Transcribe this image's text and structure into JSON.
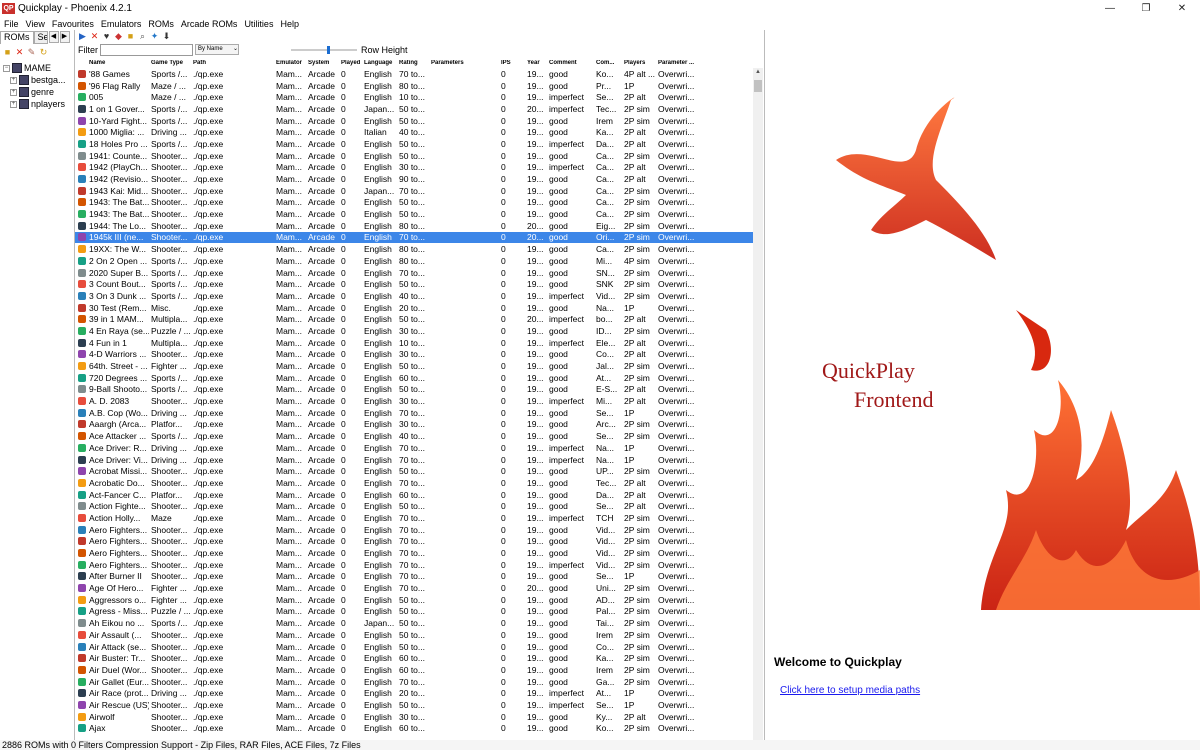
{
  "window": {
    "title": "Quickplay - Phoenix 4.2.1",
    "app_icon": "QP"
  },
  "menu": [
    "File",
    "View",
    "Favourites",
    "Emulators",
    "ROMs",
    "Arcade ROMs",
    "Utilities",
    "Help"
  ],
  "left": {
    "tabs": [
      "ROMs",
      "Se"
    ],
    "tree": [
      {
        "label": "MAME",
        "expander": "−"
      },
      {
        "label": "bestga...",
        "expander": "+"
      },
      {
        "label": "genre",
        "expander": "+"
      },
      {
        "label": "nplayers",
        "expander": "+"
      }
    ]
  },
  "filter": {
    "label": "Filter",
    "value": "",
    "sort": "By Name",
    "row_height_label": "Row Height"
  },
  "columns": [
    "Name",
    "Game Type",
    "Path",
    "Emulator",
    "System",
    "Played",
    "Language",
    "Rating",
    "Parameters",
    "IPS",
    "Year",
    "Comment",
    "Com...",
    "Players",
    "Parameter ..."
  ],
  "icon_colors": [
    "#c0392b",
    "#d35400",
    "#27ae60",
    "#2c3e50",
    "#8e44ad",
    "#f39c12",
    "#16a085",
    "#7f8c8d",
    "#e74c3c",
    "#2980b9"
  ],
  "rows": [
    {
      "name": "'88 Games",
      "type": "Sports /...",
      "lang": "English",
      "rating": "70 to...",
      "year": "19...",
      "comment": "good",
      "comp": "Ko...",
      "players": "4P alt ..."
    },
    {
      "name": "'96 Flag Rally",
      "type": "Maze / ...",
      "lang": "English",
      "rating": "80 to...",
      "year": "19...",
      "comment": "good",
      "comp": "Pr...",
      "players": "1P"
    },
    {
      "name": "005",
      "type": "Maze / ...",
      "lang": "English",
      "rating": "10 to...",
      "year": "19...",
      "comment": "imperfect",
      "comp": "Se...",
      "players": "2P alt"
    },
    {
      "name": "1 on 1 Gover...",
      "type": "Sports /...",
      "lang": "Japan...",
      "rating": "50 to...",
      "year": "20...",
      "comment": "imperfect",
      "comp": "Tec...",
      "players": "2P sim"
    },
    {
      "name": "10-Yard Fight...",
      "type": "Sports /...",
      "lang": "English",
      "rating": "50 to...",
      "year": "19...",
      "comment": "good",
      "comp": "Irem",
      "players": "2P sim"
    },
    {
      "name": "1000 Miglia: ...",
      "type": "Driving ...",
      "lang": "Italian",
      "rating": "40 to...",
      "year": "19...",
      "comment": "good",
      "comp": "Ka...",
      "players": "2P alt"
    },
    {
      "name": "18 Holes Pro ...",
      "type": "Sports /...",
      "lang": "English",
      "rating": "50 to...",
      "year": "19...",
      "comment": "imperfect",
      "comp": "Da...",
      "players": "2P alt"
    },
    {
      "name": "1941: Counte...",
      "type": "Shooter...",
      "lang": "English",
      "rating": "50 to...",
      "year": "19...",
      "comment": "good",
      "comp": "Ca...",
      "players": "2P sim"
    },
    {
      "name": "1942 (PlayCh...",
      "type": "Shooter...",
      "lang": "English",
      "rating": "30 to...",
      "year": "19...",
      "comment": "imperfect",
      "comp": "Ca...",
      "players": "2P alt"
    },
    {
      "name": "1942 (Revisio...",
      "type": "Shooter...",
      "lang": "English",
      "rating": "90 to...",
      "year": "19...",
      "comment": "good",
      "comp": "Ca...",
      "players": "2P alt"
    },
    {
      "name": "1943 Kai: Mid...",
      "type": "Shooter...",
      "lang": "Japan...",
      "rating": "70 to...",
      "year": "19...",
      "comment": "good",
      "comp": "Ca...",
      "players": "2P sim"
    },
    {
      "name": "1943: The Bat...",
      "type": "Shooter...",
      "lang": "English",
      "rating": "50 to...",
      "year": "19...",
      "comment": "good",
      "comp": "Ca...",
      "players": "2P sim"
    },
    {
      "name": "1943: The Bat...",
      "type": "Shooter...",
      "lang": "English",
      "rating": "50 to...",
      "year": "19...",
      "comment": "good",
      "comp": "Ca...",
      "players": "2P sim"
    },
    {
      "name": "1944: The Lo...",
      "type": "Shooter...",
      "lang": "English",
      "rating": "80 to...",
      "year": "20...",
      "comment": "good",
      "comp": "Eig...",
      "players": "2P sim"
    },
    {
      "name": "1945k III (ne...",
      "type": "Shooter...",
      "lang": "English",
      "rating": "70 to...",
      "year": "20...",
      "comment": "good",
      "comp": "Ori...",
      "players": "2P sim",
      "selected": true
    },
    {
      "name": "19XX: The W...",
      "type": "Shooter...",
      "lang": "English",
      "rating": "80 to...",
      "year": "19...",
      "comment": "good",
      "comp": "Ca...",
      "players": "2P sim"
    },
    {
      "name": "2 On 2 Open ...",
      "type": "Sports /...",
      "lang": "English",
      "rating": "80 to...",
      "year": "19...",
      "comment": "good",
      "comp": "Mi...",
      "players": "4P sim"
    },
    {
      "name": "2020 Super B...",
      "type": "Sports /...",
      "lang": "English",
      "rating": "70 to...",
      "year": "19...",
      "comment": "good",
      "comp": "SN...",
      "players": "2P sim"
    },
    {
      "name": "3 Count Bout...",
      "type": "Sports /...",
      "lang": "English",
      "rating": "50 to...",
      "year": "19...",
      "comment": "good",
      "comp": "SNK",
      "players": "2P sim"
    },
    {
      "name": "3 On 3 Dunk ...",
      "type": "Sports /...",
      "lang": "English",
      "rating": "40 to...",
      "year": "19...",
      "comment": "imperfect",
      "comp": "Vid...",
      "players": "2P sim"
    },
    {
      "name": "30 Test (Rem...",
      "type": "Misc.",
      "lang": "English",
      "rating": "20 to...",
      "year": "19...",
      "comment": "good",
      "comp": "Na...",
      "players": "1P"
    },
    {
      "name": "39 in 1 MAM...",
      "type": "Multipla...",
      "lang": "English",
      "rating": "50 to...",
      "year": "20...",
      "comment": "imperfect",
      "comp": "bo...",
      "players": "2P alt"
    },
    {
      "name": "4 En Raya (se...",
      "type": "Puzzle / ...",
      "lang": "English",
      "rating": "30 to...",
      "year": "19...",
      "comment": "good",
      "comp": "ID...",
      "players": "2P sim"
    },
    {
      "name": "4 Fun in 1",
      "type": "Multipla...",
      "lang": "English",
      "rating": "10 to...",
      "year": "19...",
      "comment": "imperfect",
      "comp": "Ele...",
      "players": "2P alt"
    },
    {
      "name": "4-D Warriors ...",
      "type": "Shooter...",
      "lang": "English",
      "rating": "30 to...",
      "year": "19...",
      "comment": "good",
      "comp": "Co...",
      "players": "2P alt"
    },
    {
      "name": "64th. Street - ...",
      "type": "Fighter ...",
      "lang": "English",
      "rating": "50 to...",
      "year": "19...",
      "comment": "good",
      "comp": "Jal...",
      "players": "2P sim"
    },
    {
      "name": "720 Degrees ...",
      "type": "Sports /...",
      "lang": "English",
      "rating": "60 to...",
      "year": "19...",
      "comment": "good",
      "comp": "At...",
      "players": "2P sim"
    },
    {
      "name": "9-Ball Shooto...",
      "type": "Sports /...",
      "lang": "English",
      "rating": "50 to...",
      "year": "19...",
      "comment": "good",
      "comp": "E-S...",
      "players": "2P alt"
    },
    {
      "name": "A. D. 2083",
      "type": "Shooter...",
      "lang": "English",
      "rating": "30 to...",
      "year": "19...",
      "comment": "imperfect",
      "comp": "Mi...",
      "players": "2P alt"
    },
    {
      "name": "A.B. Cop (Wo...",
      "type": "Driving ...",
      "lang": "English",
      "rating": "70 to...",
      "year": "19...",
      "comment": "good",
      "comp": "Se...",
      "players": "1P"
    },
    {
      "name": "Aaargh (Arca...",
      "type": "Platfor...",
      "lang": "English",
      "rating": "30 to...",
      "year": "19...",
      "comment": "good",
      "comp": "Arc...",
      "players": "2P sim"
    },
    {
      "name": "Ace Attacker ...",
      "type": "Sports /...",
      "lang": "English",
      "rating": "40 to...",
      "year": "19...",
      "comment": "good",
      "comp": "Se...",
      "players": "2P sim"
    },
    {
      "name": "Ace Driver: R...",
      "type": "Driving ...",
      "lang": "English",
      "rating": "70 to...",
      "year": "19...",
      "comment": "imperfect",
      "comp": "Na...",
      "players": "1P"
    },
    {
      "name": "Ace Driver: Vi...",
      "type": "Driving ...",
      "lang": "English",
      "rating": "70 to...",
      "year": "19...",
      "comment": "imperfect",
      "comp": "Na...",
      "players": "1P"
    },
    {
      "name": "Acrobat Missi...",
      "type": "Shooter...",
      "lang": "English",
      "rating": "50 to...",
      "year": "19...",
      "comment": "good",
      "comp": "UP...",
      "players": "2P sim"
    },
    {
      "name": "Acrobatic Do...",
      "type": "Shooter...",
      "lang": "English",
      "rating": "70 to...",
      "year": "19...",
      "comment": "good",
      "comp": "Tec...",
      "players": "2P alt"
    },
    {
      "name": "Act-Fancer C...",
      "type": "Platfor...",
      "lang": "English",
      "rating": "60 to...",
      "year": "19...",
      "comment": "good",
      "comp": "Da...",
      "players": "2P alt"
    },
    {
      "name": "Action Fighte...",
      "type": "Shooter...",
      "lang": "English",
      "rating": "50 to...",
      "year": "19...",
      "comment": "good",
      "comp": "Se...",
      "players": "2P alt"
    },
    {
      "name": "Action Holly...",
      "type": "Maze",
      "lang": "English",
      "rating": "70 to...",
      "year": "19...",
      "comment": "imperfect",
      "comp": "TCH",
      "players": "2P sim"
    },
    {
      "name": "Aero Fighters...",
      "type": "Shooter...",
      "lang": "English",
      "rating": "70 to...",
      "year": "19...",
      "comment": "good",
      "comp": "Vid...",
      "players": "2P sim"
    },
    {
      "name": "Aero Fighters...",
      "type": "Shooter...",
      "lang": "English",
      "rating": "70 to...",
      "year": "19...",
      "comment": "good",
      "comp": "Vid...",
      "players": "2P sim"
    },
    {
      "name": "Aero Fighters...",
      "type": "Shooter...",
      "lang": "English",
      "rating": "70 to...",
      "year": "19...",
      "comment": "good",
      "comp": "Vid...",
      "players": "2P sim"
    },
    {
      "name": "Aero Fighters...",
      "type": "Shooter...",
      "lang": "English",
      "rating": "70 to...",
      "year": "19...",
      "comment": "imperfect",
      "comp": "Vid...",
      "players": "2P sim"
    },
    {
      "name": "After Burner II",
      "type": "Shooter...",
      "lang": "English",
      "rating": "70 to...",
      "year": "19...",
      "comment": "good",
      "comp": "Se...",
      "players": "1P"
    },
    {
      "name": "Age Of Hero...",
      "type": "Fighter ...",
      "lang": "English",
      "rating": "70 to...",
      "year": "20...",
      "comment": "good",
      "comp": "Uni...",
      "players": "2P sim"
    },
    {
      "name": "Aggressors o...",
      "type": "Fighter ...",
      "lang": "English",
      "rating": "50 to...",
      "year": "19...",
      "comment": "good",
      "comp": "AD...",
      "players": "2P sim"
    },
    {
      "name": "Agress - Miss...",
      "type": "Puzzle / ...",
      "lang": "English",
      "rating": "50 to...",
      "year": "19...",
      "comment": "good",
      "comp": "Pal...",
      "players": "2P sim"
    },
    {
      "name": "Ah Eikou no ...",
      "type": "Sports /...",
      "lang": "Japan...",
      "rating": "50 to...",
      "year": "19...",
      "comment": "good",
      "comp": "Tai...",
      "players": "2P sim"
    },
    {
      "name": "Air Assault (...",
      "type": "Shooter...",
      "lang": "English",
      "rating": "50 to...",
      "year": "19...",
      "comment": "good",
      "comp": "Irem",
      "players": "2P sim"
    },
    {
      "name": "Air Attack (se...",
      "type": "Shooter...",
      "lang": "English",
      "rating": "50 to...",
      "year": "19...",
      "comment": "good",
      "comp": "Co...",
      "players": "2P sim"
    },
    {
      "name": "Air Buster: Tr...",
      "type": "Shooter...",
      "lang": "English",
      "rating": "60 to...",
      "year": "19...",
      "comment": "good",
      "comp": "Ka...",
      "players": "2P sim"
    },
    {
      "name": "Air Duel (Wor...",
      "type": "Shooter...",
      "lang": "English",
      "rating": "60 to...",
      "year": "19...",
      "comment": "good",
      "comp": "Irem",
      "players": "2P sim"
    },
    {
      "name": "Air Gallet (Eur...",
      "type": "Shooter...",
      "lang": "English",
      "rating": "70 to...",
      "year": "19...",
      "comment": "good",
      "comp": "Ga...",
      "players": "2P sim"
    },
    {
      "name": "Air Race (prot...",
      "type": "Driving ...",
      "lang": "English",
      "rating": "20 to...",
      "year": "19...",
      "comment": "imperfect",
      "comp": "At...",
      "players": "1P"
    },
    {
      "name": "Air Rescue (US)",
      "type": "Shooter...",
      "lang": "English",
      "rating": "50 to...",
      "year": "19...",
      "comment": "imperfect",
      "comp": "Se...",
      "players": "1P"
    },
    {
      "name": "Airwolf",
      "type": "Shooter...",
      "lang": "English",
      "rating": "30 to...",
      "year": "19...",
      "comment": "good",
      "comp": "Ky...",
      "players": "2P alt"
    },
    {
      "name": "Ajax",
      "type": "Shooter...",
      "lang": "English",
      "rating": "60 to...",
      "year": "19...",
      "comment": "good",
      "comp": "Ko...",
      "players": "2P sim"
    }
  ],
  "row_defaults": {
    "path": "./qp.exe",
    "emu": "Mam...",
    "sys": "Arcade",
    "played": "0",
    "ips": "0",
    "param2": "Overwri..."
  },
  "right": {
    "logo_line1": "QuickPlay",
    "logo_line2": "Frontend",
    "welcome": "Welcome to Quickplay",
    "setup_link": "Click here to setup media paths"
  },
  "status": "2886 ROMs with 0 Filters Compression Support - Zip Files, RAR Files, ACE Files, 7z Files"
}
